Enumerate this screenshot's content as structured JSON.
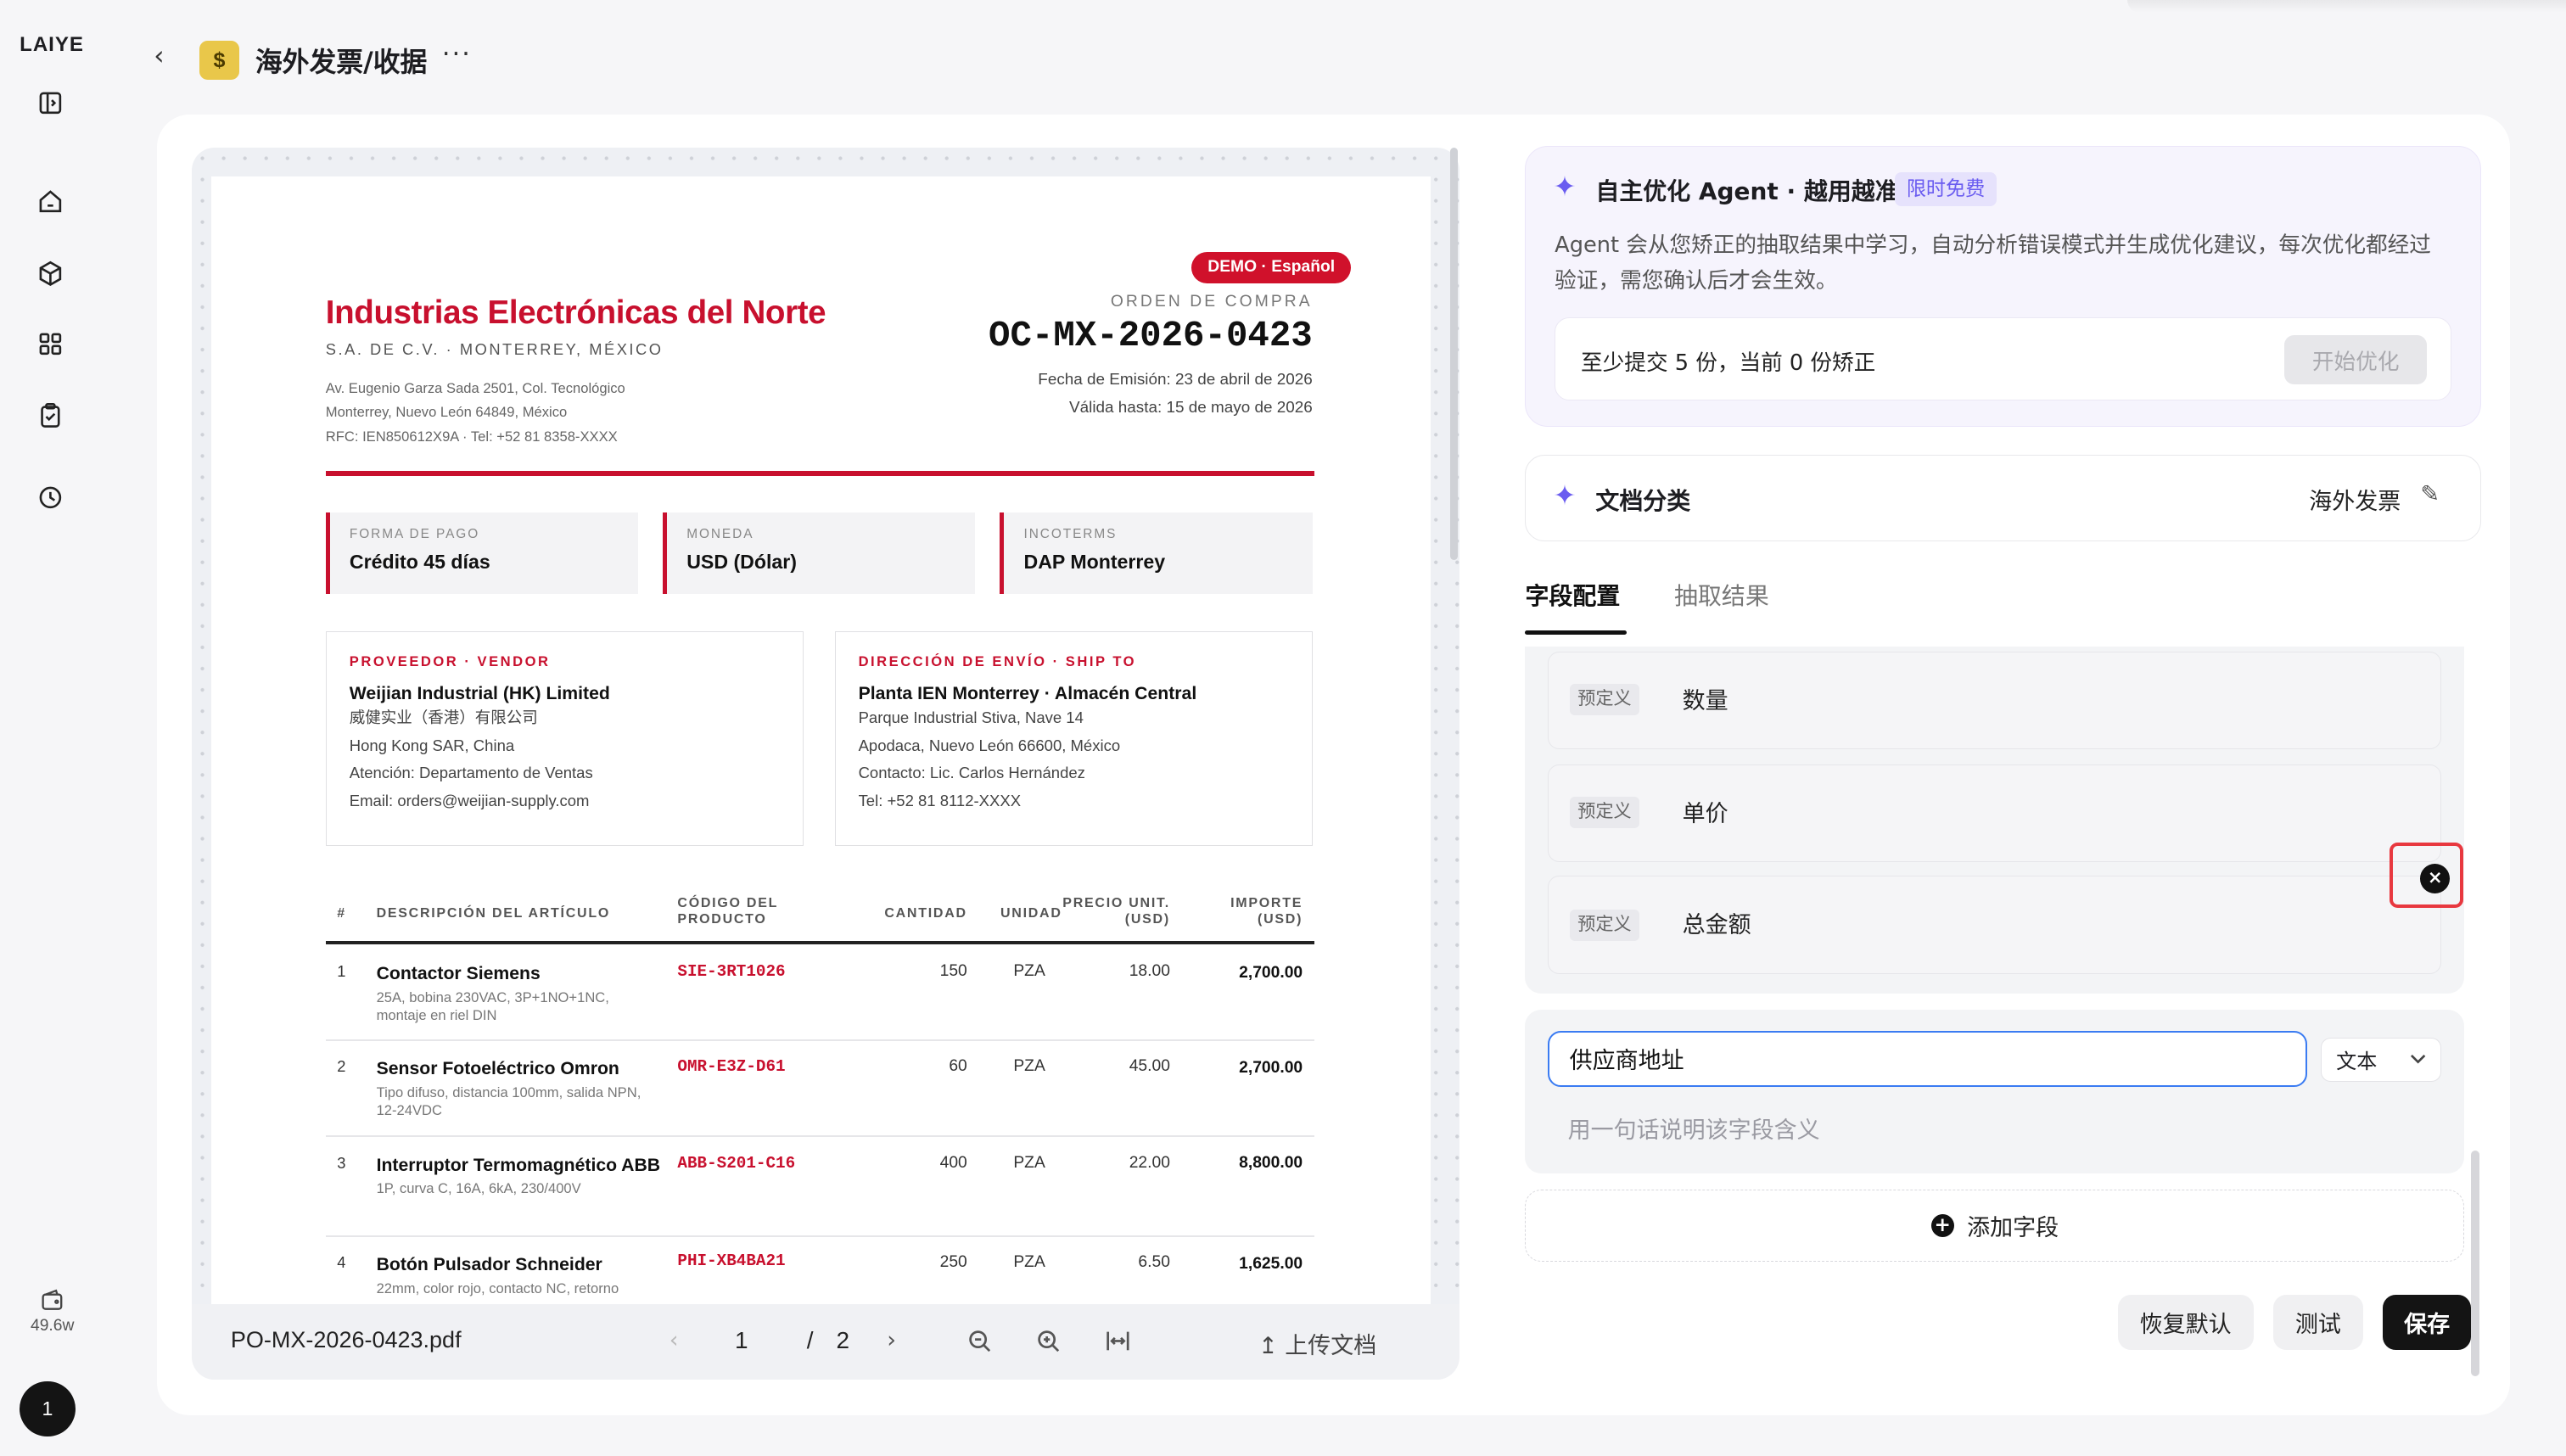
{
  "rail": {
    "logo": "LAIYE",
    "nav_icons": [
      "sidebar-toggle-icon",
      "home-icon",
      "cube-icon",
      "grid-icon",
      "clipboard-check-icon",
      "clock-icon"
    ],
    "credit": "49.6w",
    "user_badge": "1"
  },
  "header": {
    "back_icon": "chevron-left-icon",
    "app_icon_text": "$",
    "title": "海外发票/收据",
    "more": "···"
  },
  "document": {
    "badge": "DEMO · Español",
    "company": "Industrias Electrónicas del Norte",
    "company_sub": "S.A. DE C.V. · MONTERREY, MÉXICO",
    "address": [
      "Av. Eugenio Garza Sada 2501, Col. Tecnológico",
      "Monterrey, Nuevo León 64849, México",
      "RFC: IEN850612X9A · Tel: +52 81 8358-XXXX"
    ],
    "order_label": "ORDEN DE COMPRA",
    "order_number": "OC-MX-2026-0423",
    "issue_date": "Fecha de Emisión: 23 de abril de 2026",
    "valid_until": "Válida hasta: 15 de mayo de 2026",
    "terms": [
      {
        "label": "FORMA DE PAGO",
        "value": "Crédito 45 días"
      },
      {
        "label": "MONEDA",
        "value": "USD (Dólar)"
      },
      {
        "label": "INCOTERMS",
        "value": "DAP Monterrey"
      }
    ],
    "vendor": {
      "title": "PROVEEDOR · VENDOR",
      "name": "Weijian Industrial (HK) Limited",
      "lines": [
        "威健实业（香港）有限公司",
        "Hong Kong SAR, China",
        "Atención: Departamento de Ventas",
        "Email: orders@weijian-supply.com"
      ]
    },
    "ship_to": {
      "title": "DIRECCIÓN DE ENVÍO · SHIP TO",
      "name": "Planta IEN Monterrey · Almacén Central",
      "lines": [
        "Parque Industrial Stiva, Nave 14",
        "Apodaca, Nuevo León 66600, México",
        "Contacto: Lic. Carlos Hernández",
        "Tel: +52 81 8112-XXXX"
      ]
    },
    "table_headers": {
      "num": "#",
      "desc": "DESCRIPCIÓN DEL ARTÍCULO",
      "code": "CÓDIGO DEL PRODUCTO",
      "qty": "CANTIDAD",
      "unit": "UNIDAD",
      "price": "PRECIO UNIT. (USD)",
      "total": "IMPORTE (USD)"
    },
    "items": [
      {
        "num": "1",
        "desc": "Contactor Siemens",
        "sub": "25A, bobina 230VAC, 3P+1NO+1NC, montaje en riel DIN",
        "code": "SIE-3RT1026",
        "qty": "150",
        "unit": "PZA",
        "price": "18.00",
        "total": "2,700.00"
      },
      {
        "num": "2",
        "desc": "Sensor Fotoeléctrico Omron",
        "sub": "Tipo difuso, distancia 100mm, salida NPN, 12-24VDC",
        "code": "OMR-E3Z-D61",
        "qty": "60",
        "unit": "PZA",
        "price": "45.00",
        "total": "2,700.00"
      },
      {
        "num": "3",
        "desc": "Interruptor Termomagnético ABB",
        "sub": "1P, curva C, 16A, 6kA, 230/400V",
        "code": "ABB-S201-C16",
        "qty": "400",
        "unit": "PZA",
        "price": "22.00",
        "total": "8,800.00"
      },
      {
        "num": "4",
        "desc": "Botón Pulsador Schneider",
        "sub": "22mm, color rojo, contacto NC, retorno",
        "code": "PHI-XB4BA21",
        "qty": "250",
        "unit": "PZA",
        "price": "6.50",
        "total": "1,625.00"
      }
    ]
  },
  "preview_toolbar": {
    "filename": "PO-MX-2026-0423.pdf",
    "current_page": "1",
    "page_sep": "/",
    "total_pages": "2",
    "upload_label": "上传文档"
  },
  "agent": {
    "title": "自主优化 Agent · 越用越准",
    "tag": "限时免费",
    "description": "Agent 会从您矫正的抽取结果中学习，自动分析错误模式并生成优化建议，每次优化都经过验证，需您确认后才会生效。",
    "status": "至少提交 5 份，当前 0 份矫正",
    "start_button": "开始优化"
  },
  "doc_class": {
    "label": "文档分类",
    "value": "海外发票"
  },
  "tabs": {
    "field_config": "字段配置",
    "extract_result": "抽取结果"
  },
  "fields": [
    {
      "tag": "预定义",
      "name": "数量"
    },
    {
      "tag": "预定义",
      "name": "单价"
    },
    {
      "tag": "预定义",
      "name": "总金额"
    }
  ],
  "new_field": {
    "name_value": "供应商地址",
    "type": "文本",
    "desc_placeholder": "用一句话说明该字段含义"
  },
  "add_field_label": "添加字段",
  "buttons": {
    "reset": "恢复默认",
    "test": "测试",
    "save": "保存"
  },
  "colors": {
    "accent": "#6a5cf0",
    "doc_red": "#c8102e",
    "focus_blue": "#3a7bf2",
    "highlight_red": "#e8383f"
  }
}
